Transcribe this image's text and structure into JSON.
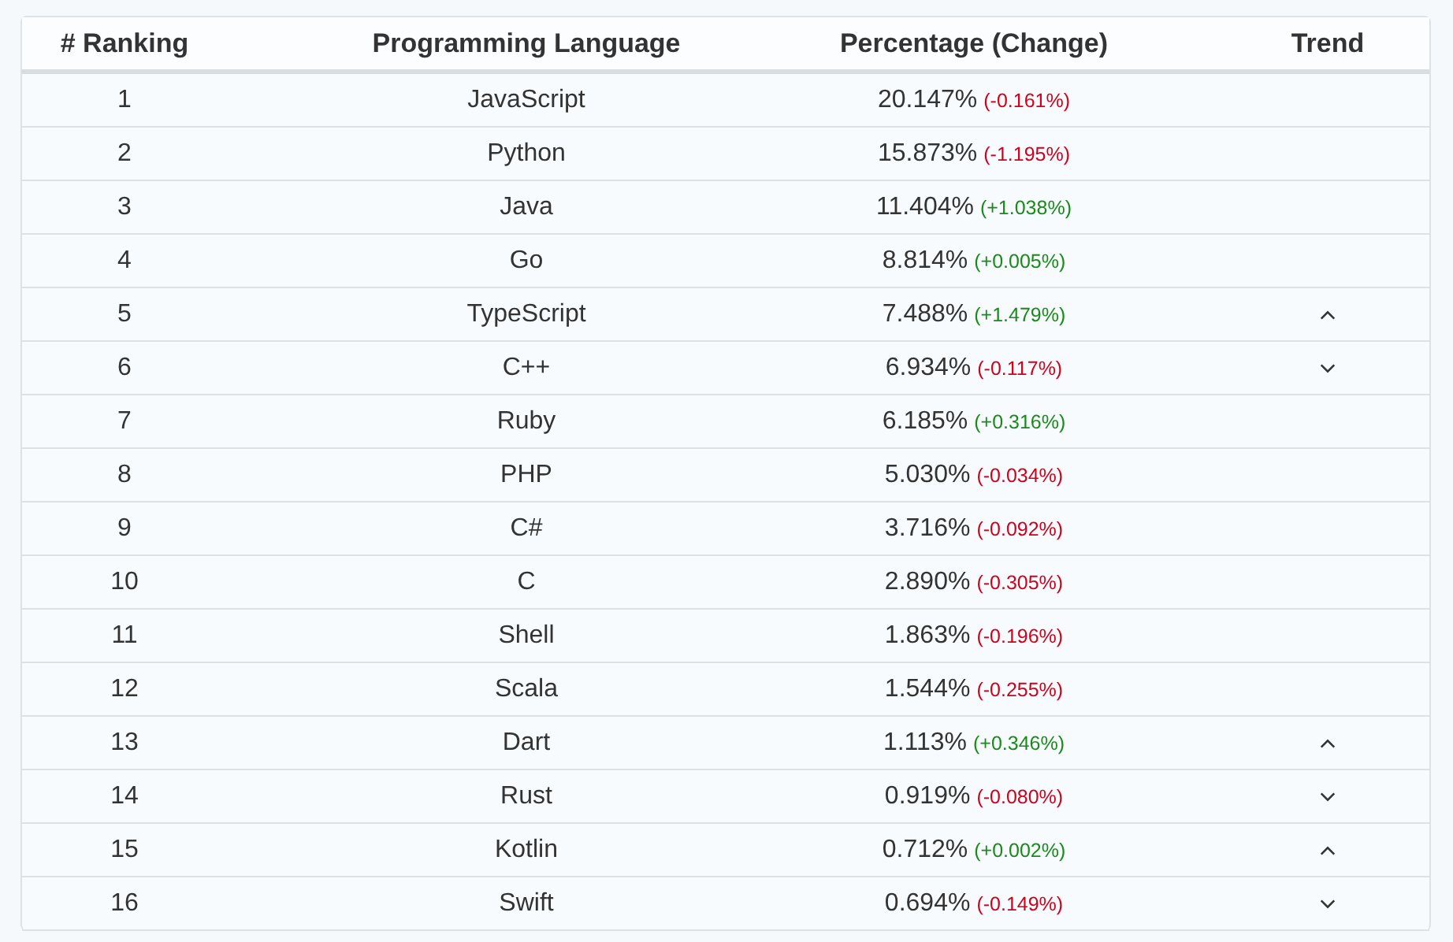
{
  "table": {
    "columns": [
      "# Ranking",
      "Programming Language",
      "Percentage (Change)",
      "Trend"
    ],
    "rows": [
      {
        "rank": "1",
        "language": "JavaScript",
        "percentage": "20.147%",
        "change": "(-0.161%)",
        "rising": false,
        "trend_up": false,
        "trend_down": false
      },
      {
        "rank": "2",
        "language": "Python",
        "percentage": "15.873%",
        "change": "(-1.195%)",
        "rising": false,
        "trend_up": false,
        "trend_down": false
      },
      {
        "rank": "3",
        "language": "Java",
        "percentage": "11.404%",
        "change": "(+1.038%)",
        "rising": true,
        "trend_up": false,
        "trend_down": false
      },
      {
        "rank": "4",
        "language": "Go",
        "percentage": "8.814%",
        "change": "(+0.005%)",
        "rising": true,
        "trend_up": false,
        "trend_down": false
      },
      {
        "rank": "5",
        "language": "TypeScript",
        "percentage": "7.488%",
        "change": "(+1.479%)",
        "rising": true,
        "trend_up": true,
        "trend_down": false
      },
      {
        "rank": "6",
        "language": "C++",
        "percentage": "6.934%",
        "change": "(-0.117%)",
        "rising": false,
        "trend_up": false,
        "trend_down": true
      },
      {
        "rank": "7",
        "language": "Ruby",
        "percentage": "6.185%",
        "change": "(+0.316%)",
        "rising": true,
        "trend_up": false,
        "trend_down": false
      },
      {
        "rank": "8",
        "language": "PHP",
        "percentage": "5.030%",
        "change": "(-0.034%)",
        "rising": false,
        "trend_up": false,
        "trend_down": false
      },
      {
        "rank": "9",
        "language": "C#",
        "percentage": "3.716%",
        "change": "(-0.092%)",
        "rising": false,
        "trend_up": false,
        "trend_down": false
      },
      {
        "rank": "10",
        "language": "C",
        "percentage": "2.890%",
        "change": "(-0.305%)",
        "rising": false,
        "trend_up": false,
        "trend_down": false
      },
      {
        "rank": "11",
        "language": "Shell",
        "percentage": "1.863%",
        "change": "(-0.196%)",
        "rising": false,
        "trend_up": false,
        "trend_down": false
      },
      {
        "rank": "12",
        "language": "Scala",
        "percentage": "1.544%",
        "change": "(-0.255%)",
        "rising": false,
        "trend_up": false,
        "trend_down": false
      },
      {
        "rank": "13",
        "language": "Dart",
        "percentage": "1.113%",
        "change": "(+0.346%)",
        "rising": true,
        "trend_up": true,
        "trend_down": false
      },
      {
        "rank": "14",
        "language": "Rust",
        "percentage": "0.919%",
        "change": "(-0.080%)",
        "rising": false,
        "trend_up": false,
        "trend_down": true
      },
      {
        "rank": "15",
        "language": "Kotlin",
        "percentage": "0.712%",
        "change": "(+0.002%)",
        "rising": true,
        "trend_up": true,
        "trend_down": false
      },
      {
        "rank": "16",
        "language": "Swift",
        "percentage": "0.694%",
        "change": "(-0.149%)",
        "rising": false,
        "trend_up": false,
        "trend_down": true
      }
    ]
  }
}
